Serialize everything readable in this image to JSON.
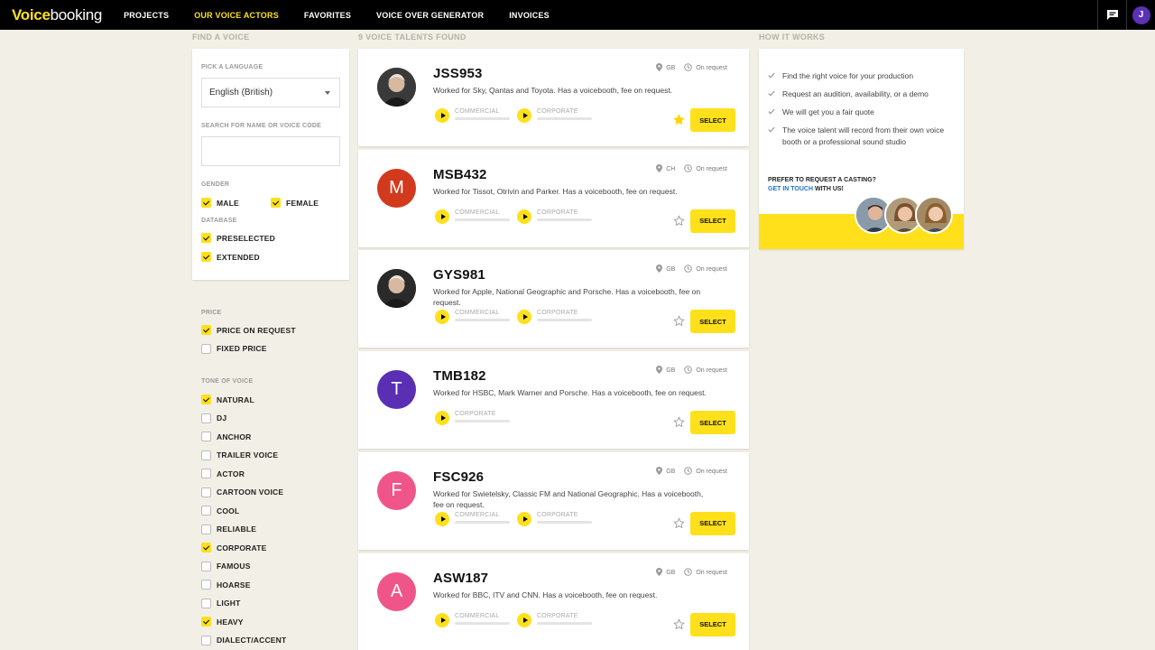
{
  "app": {
    "logo_left": "Voice",
    "logo_right": "booking"
  },
  "nav": {
    "items": [
      {
        "label": "PROJECTS",
        "active": false
      },
      {
        "label": "OUR VOICE ACTORS",
        "active": true
      },
      {
        "label": "FAVORITES",
        "active": false
      },
      {
        "label": "VOICE OVER GENERATOR",
        "active": false
      },
      {
        "label": "INVOICES",
        "active": false
      }
    ],
    "user_initial": "J",
    "chat_icon": "chat-icon"
  },
  "filters": {
    "title": "FIND A VOICE",
    "language_label": "PICK A LANGUAGE",
    "language_value": "English (British)",
    "search_label": "SEARCH FOR NAME OR VOICE CODE",
    "search_value": "",
    "gender_label": "GENDER",
    "gender": [
      {
        "label": "MALE",
        "checked": true
      },
      {
        "label": "FEMALE",
        "checked": true
      }
    ],
    "database_label": "DATABASE",
    "database": [
      {
        "label": "PRESELECTED",
        "checked": true
      },
      {
        "label": "EXTENDED",
        "checked": true
      }
    ],
    "price_label": "PRICE",
    "price": [
      {
        "label": "PRICE ON REQUEST",
        "checked": true
      },
      {
        "label": "FIXED PRICE",
        "checked": false
      }
    ],
    "tone_label": "TONE OF VOICE",
    "tone": [
      {
        "label": "NATURAL",
        "checked": true
      },
      {
        "label": "DJ",
        "checked": false
      },
      {
        "label": "ANCHOR",
        "checked": false
      },
      {
        "label": "TRAILER VOICE",
        "checked": false
      },
      {
        "label": "ACTOR",
        "checked": false
      },
      {
        "label": "CARTOON VOICE",
        "checked": false
      },
      {
        "label": "COOL",
        "checked": false
      },
      {
        "label": "RELIABLE",
        "checked": false
      },
      {
        "label": "CORPORATE",
        "checked": true
      },
      {
        "label": "FAMOUS",
        "checked": false
      },
      {
        "label": "HOARSE",
        "checked": false
      },
      {
        "label": "LIGHT",
        "checked": false
      },
      {
        "label": "HEAVY",
        "checked": true
      },
      {
        "label": "DIALECT/ACCENT",
        "checked": false
      }
    ]
  },
  "results": {
    "title": "9 VOICE TALENTS FOUND",
    "select_label": "SELECT",
    "talents": [
      {
        "code": "JSS953",
        "desc": "Worked for Sky, Qantas and Toyota. Has a voicebooth, fee on request.",
        "country": "GB",
        "fee": "On request",
        "initial": "",
        "avatar_color": "#3a3a3a",
        "photo": true,
        "favorite": true,
        "samples": [
          "COMMERCIAL",
          "CORPORATE"
        ]
      },
      {
        "code": "MSB432",
        "desc": "Worked for Tissot, Otrivin and Parker. Has a voicebooth, fee on request.",
        "country": "CH",
        "fee": "On request",
        "initial": "M",
        "avatar_color": "#d23a1e",
        "photo": false,
        "favorite": false,
        "samples": [
          "COMMERCIAL",
          "CORPORATE"
        ]
      },
      {
        "code": "GYS981",
        "desc": "Worked for Apple, National Geographic and Porsche. Has a voicebooth, fee on request.",
        "country": "GB",
        "fee": "On request",
        "initial": "",
        "avatar_color": "#2a2a2a",
        "photo": true,
        "favorite": false,
        "samples": [
          "COMMERCIAL",
          "CORPORATE"
        ]
      },
      {
        "code": "TMB182",
        "desc": "Worked for HSBC, Mark Warner and Porsche. Has a voicebooth, fee on request.",
        "country": "GB",
        "fee": "On request",
        "initial": "T",
        "avatar_color": "#5a2fb4",
        "photo": false,
        "favorite": false,
        "samples": [
          "CORPORATE"
        ]
      },
      {
        "code": "FSC926",
        "desc": "Worked for Swietelsky, Classic FM and National Geographic. Has a voicebooth, fee on request.",
        "country": "GB",
        "fee": "On request",
        "initial": "F",
        "avatar_color": "#f0558a",
        "photo": false,
        "favorite": false,
        "samples": [
          "COMMERCIAL",
          "CORPORATE"
        ]
      },
      {
        "code": "ASW187",
        "desc": "Worked for BBC, ITV and CNN. Has a voicebooth, fee on request.",
        "country": "GB",
        "fee": "On request",
        "initial": "A",
        "avatar_color": "#f0558a",
        "photo": false,
        "favorite": false,
        "samples": [
          "COMMERCIAL",
          "CORPORATE"
        ]
      }
    ]
  },
  "how": {
    "title": "HOW IT WORKS",
    "steps": [
      "Find the right voice for your production",
      "Request an audition, availability, or a demo",
      "We will get you a fair quote",
      "The voice talent will record from their own voice booth or a professional sound studio"
    ],
    "casting_q": "PREFER TO REQUEST A CASTING?",
    "casting_link": "GET IN TOUCH",
    "casting_rest": " WITH US!"
  },
  "colors": {
    "accent": "#ffe01b",
    "bg": "#f2f0e6",
    "link": "#1e73d2"
  }
}
